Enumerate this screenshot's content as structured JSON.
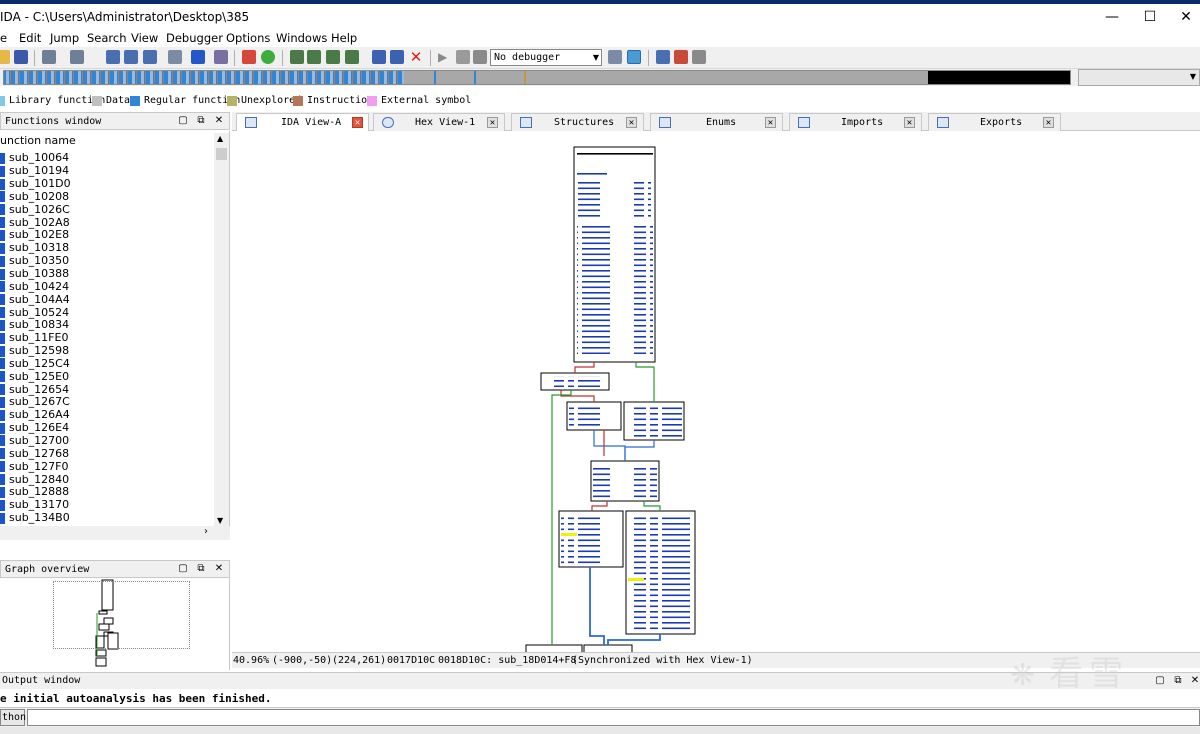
{
  "window": {
    "title": "IDA - C:\\Users\\Administrator\\Desktop\\385",
    "minimize_glyph": "—",
    "maximize_glyph": "☐",
    "close_glyph": "✕"
  },
  "menu": [
    "e",
    "Edit",
    "Jump",
    "Search",
    "View",
    "Debugger",
    "Options",
    "Windows",
    "Help"
  ],
  "toolbar": {
    "debugger_select": "No debugger",
    "icons": [
      "open-icon",
      "save-icon",
      "back-arrow-icon",
      "forward-arrow-icon",
      "find-icon",
      "find-text-icon",
      "find-binary-icon",
      "hex-icon",
      "run-to-icon",
      "search-arrow-icon",
      "chart-icon",
      "green-circle-icon",
      "graph-icon",
      "add-node-icon",
      "remove-icon",
      "delete-red-x-icon",
      "play-icon",
      "pause-icon",
      "stop-icon",
      "step-icon",
      "trace-icon",
      "breakpoint-icon",
      "tools-icon"
    ]
  },
  "legend": [
    {
      "label": "Library function",
      "color": "#7fc8e8"
    },
    {
      "label": "Data",
      "color": "#c0c0c0"
    },
    {
      "label": "Regular function",
      "color": "#2f86d6"
    },
    {
      "label": "Unexplored",
      "color": "#b5b364"
    },
    {
      "label": "Instruction",
      "color": "#b47857"
    },
    {
      "label": "External symbol",
      "color": "#f19ef1"
    }
  ],
  "functions_window": {
    "title": "Functions window",
    "column": "unction name",
    "items": [
      "sub_10064",
      "sub_10194",
      "sub_101D0",
      "sub_10208",
      "sub_1026C",
      "sub_102A8",
      "sub_102E8",
      "sub_10318",
      "sub_10350",
      "sub_10388",
      "sub_10424",
      "sub_104A4",
      "sub_10524",
      "sub_10834",
      "sub_11FE0",
      "sub_12598",
      "sub_125C4",
      "sub_125E0",
      "sub_12654",
      "sub_1267C",
      "sub_126A4",
      "sub_126E4",
      "sub_12700",
      "sub_12768",
      "sub_127F0",
      "sub_12840",
      "sub_12888",
      "sub_13170",
      "sub_134B0"
    ]
  },
  "graph_overview": {
    "title": "Graph overview"
  },
  "tabs": [
    {
      "label": "IDA View-A",
      "active": true
    },
    {
      "label": "Hex View-1",
      "active": false
    },
    {
      "label": "Structures",
      "active": false
    },
    {
      "label": "Enums",
      "active": false
    },
    {
      "label": "Imports",
      "active": false
    },
    {
      "label": "Exports",
      "active": false
    }
  ],
  "status": {
    "zoom": "40.96%",
    "coords": "(-900,-50)",
    "cursor": "(224,261)",
    "addr1": "0017D10C",
    "addr2": "0018D10C: sub_18D014+F8",
    "sync": "(Synchronized with Hex View-1)"
  },
  "output": {
    "title": "Output window",
    "message": "e initial autoanalysis has been finished.",
    "python_label": "thon"
  },
  "watermark": "看雪"
}
